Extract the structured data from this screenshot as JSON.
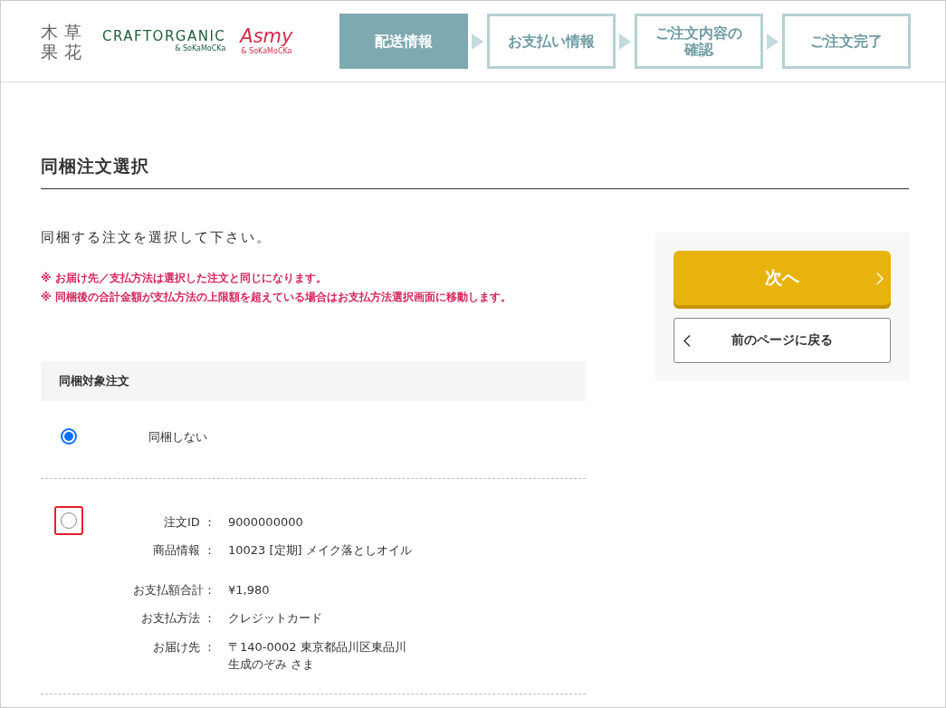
{
  "header": {
    "logos": {
      "kisoukaka": [
        "木",
        "草",
        "果",
        "花"
      ],
      "craft": {
        "name": "CRAFTORGANIC",
        "sub": "& SoKaMoCKa"
      },
      "asmy": {
        "name": "Asmy",
        "sub": "& SoKaMoCKa"
      }
    },
    "steps": [
      {
        "label": "配送情報",
        "selected": true
      },
      {
        "label": "お支払い情報",
        "selected": false
      },
      {
        "label": "ご注文内容の確認",
        "selected": false
      },
      {
        "label": "ご注文完了",
        "selected": false
      }
    ]
  },
  "page_title": "同梱注文選択",
  "instruction": "同梱する注文を選択して下さい。",
  "notes": [
    "※ お届け先／支払方法は選択した注文と同じになります。",
    "※ 同梱後の合計金額が支払方法の上限額を超えている場合はお支払方法選択画面に移動します。"
  ],
  "section_title": "同梱対象注文",
  "options": [
    {
      "kind": "none",
      "label": "同梱しない",
      "selected": true,
      "highlighted": false
    },
    {
      "kind": "order",
      "selected": false,
      "highlighted": true,
      "fields": [
        {
          "label": "注文ID ：",
          "value": "9000000000"
        },
        {
          "label": "商品情報 ：",
          "value": "10023 [定期] メイク落としオイル"
        },
        {
          "label": "お支払額合計：",
          "value": "¥1,980"
        },
        {
          "label": "お支払方法 ：",
          "value": "クレジットカード"
        },
        {
          "label": "お届け先 ：",
          "value": "〒140-0002 東京都品川区東品川",
          "value2": "生成のぞみ さま"
        }
      ]
    }
  ],
  "buttons": {
    "next": "次へ",
    "back": "前のページに戻る"
  }
}
